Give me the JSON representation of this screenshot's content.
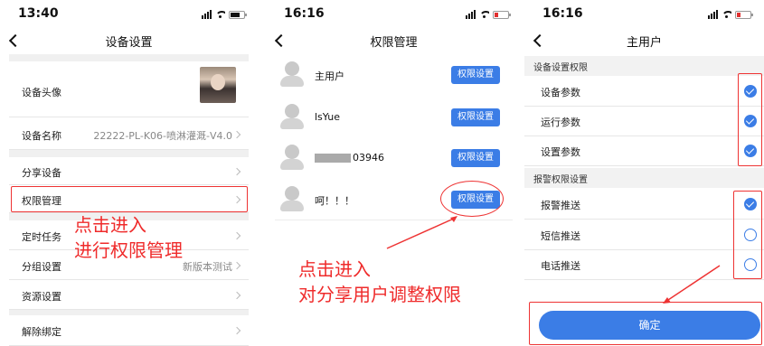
{
  "screen1": {
    "time": "13:40",
    "title": "设备设置",
    "rows": {
      "avatar": "设备头像",
      "name": "设备名称",
      "name_value": "22222-PL-K06-喷淋灌溉-V4.0",
      "share": "分享设备",
      "permissions": "权限管理",
      "timer": "定时任务",
      "group": "分组设置",
      "group_value": "新版本测试",
      "resource": "资源设置",
      "unbind": "解除绑定"
    },
    "annotation_line1": "点击进入",
    "annotation_line2": "进行权限管理"
  },
  "screen2": {
    "time": "16:16",
    "title": "权限管理",
    "users": [
      {
        "name": "主用户",
        "button": "权限设置"
      },
      {
        "name": "lsYue",
        "button": "权限设置"
      },
      {
        "name": "03946",
        "button": "权限设置"
      },
      {
        "name": "呵！！！",
        "button": "权限设置"
      }
    ],
    "annotation_line1": "点击进入",
    "annotation_line2": "对分享用户调整权限"
  },
  "screen3": {
    "time": "16:16",
    "title": "主用户",
    "section1": "设备设置权限",
    "device_items": [
      {
        "label": "设备参数",
        "checked": true
      },
      {
        "label": "运行参数",
        "checked": true
      },
      {
        "label": "设置参数",
        "checked": true
      }
    ],
    "section2": "报警权限设置",
    "alarm_items": [
      {
        "label": "报警推送",
        "checked": true
      },
      {
        "label": "短信推送",
        "checked": false
      },
      {
        "label": "电话推送",
        "checked": false
      }
    ],
    "confirm": "确定"
  },
  "colors": {
    "accent": "#3b7de6",
    "annotation": "#ef2b2b"
  }
}
